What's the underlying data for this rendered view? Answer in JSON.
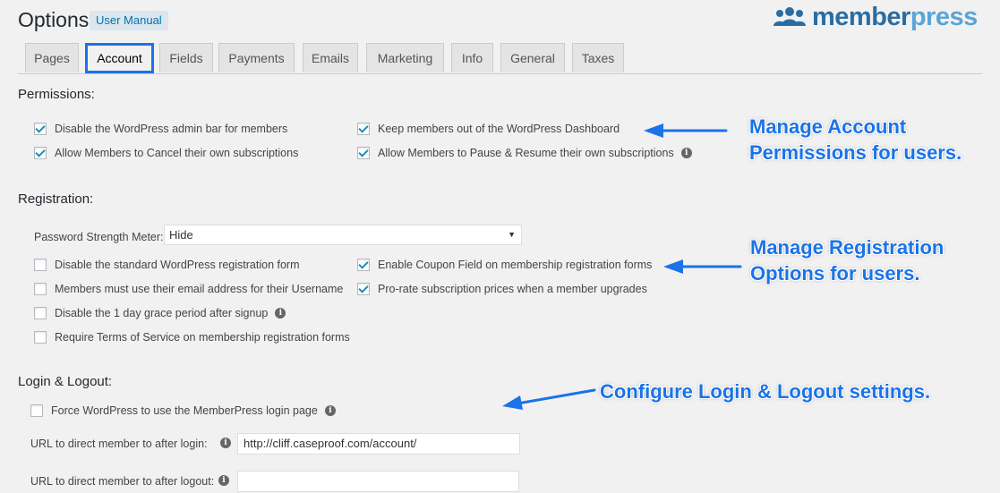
{
  "header": {
    "title": "Options",
    "manual_label": "User Manual",
    "logo_member": "member",
    "logo_press": "press"
  },
  "tabs": [
    {
      "label": "Pages",
      "active": false
    },
    {
      "label": "Account",
      "active": true
    },
    {
      "label": "Fields",
      "active": false
    },
    {
      "label": "Payments",
      "active": false
    },
    {
      "label": "Emails",
      "active": false
    },
    {
      "label": "Marketing",
      "active": false
    },
    {
      "label": "Info",
      "active": false
    },
    {
      "label": "General",
      "active": false
    },
    {
      "label": "Taxes",
      "active": false
    }
  ],
  "permissions": {
    "title": "Permissions:",
    "options": [
      {
        "label": "Disable the WordPress admin bar for members",
        "checked": true
      },
      {
        "label": "Keep members out of the WordPress Dashboard",
        "checked": true
      },
      {
        "label": "Allow Members to Cancel their own subscriptions",
        "checked": true
      },
      {
        "label": "Allow Members to Pause & Resume their own subscriptions",
        "checked": true
      }
    ]
  },
  "registration": {
    "title": "Registration:",
    "password_meter_label": "Password Strength Meter:",
    "password_meter_value": "Hide",
    "options": [
      {
        "label": "Disable the standard WordPress registration form",
        "checked": false
      },
      {
        "label": "Enable Coupon Field on membership registration forms",
        "checked": true
      },
      {
        "label": "Members must use their email address for their Username",
        "checked": false
      },
      {
        "label": "Pro-rate subscription prices when a member upgrades",
        "checked": true
      },
      {
        "label": "Disable the 1 day grace period after signup",
        "checked": false
      },
      {
        "label": "Require Terms of Service on membership registration forms",
        "checked": false
      }
    ]
  },
  "login": {
    "title": "Login & Logout:",
    "force_label": "Force WordPress to use the MemberPress login page",
    "force_checked": false,
    "login_url_label": "URL to direct member to after login:",
    "login_url_value": "http://cliff.caseproof.com/account/",
    "logout_url_label": "URL to direct member to after logout:",
    "logout_url_value": ""
  },
  "annotations": {
    "account_line1": "Manage Account",
    "account_line2": "Permissions for users.",
    "registration_line1": "Manage Registration",
    "registration_line2": "Options for users.",
    "login": "Configure Login & Logout settings."
  },
  "colors": {
    "accent": "#1a73e8",
    "link": "#0073aa",
    "checkmark": "#1e8cbe"
  },
  "icons": {
    "info": "info-icon",
    "logo": "members-group-icon"
  }
}
